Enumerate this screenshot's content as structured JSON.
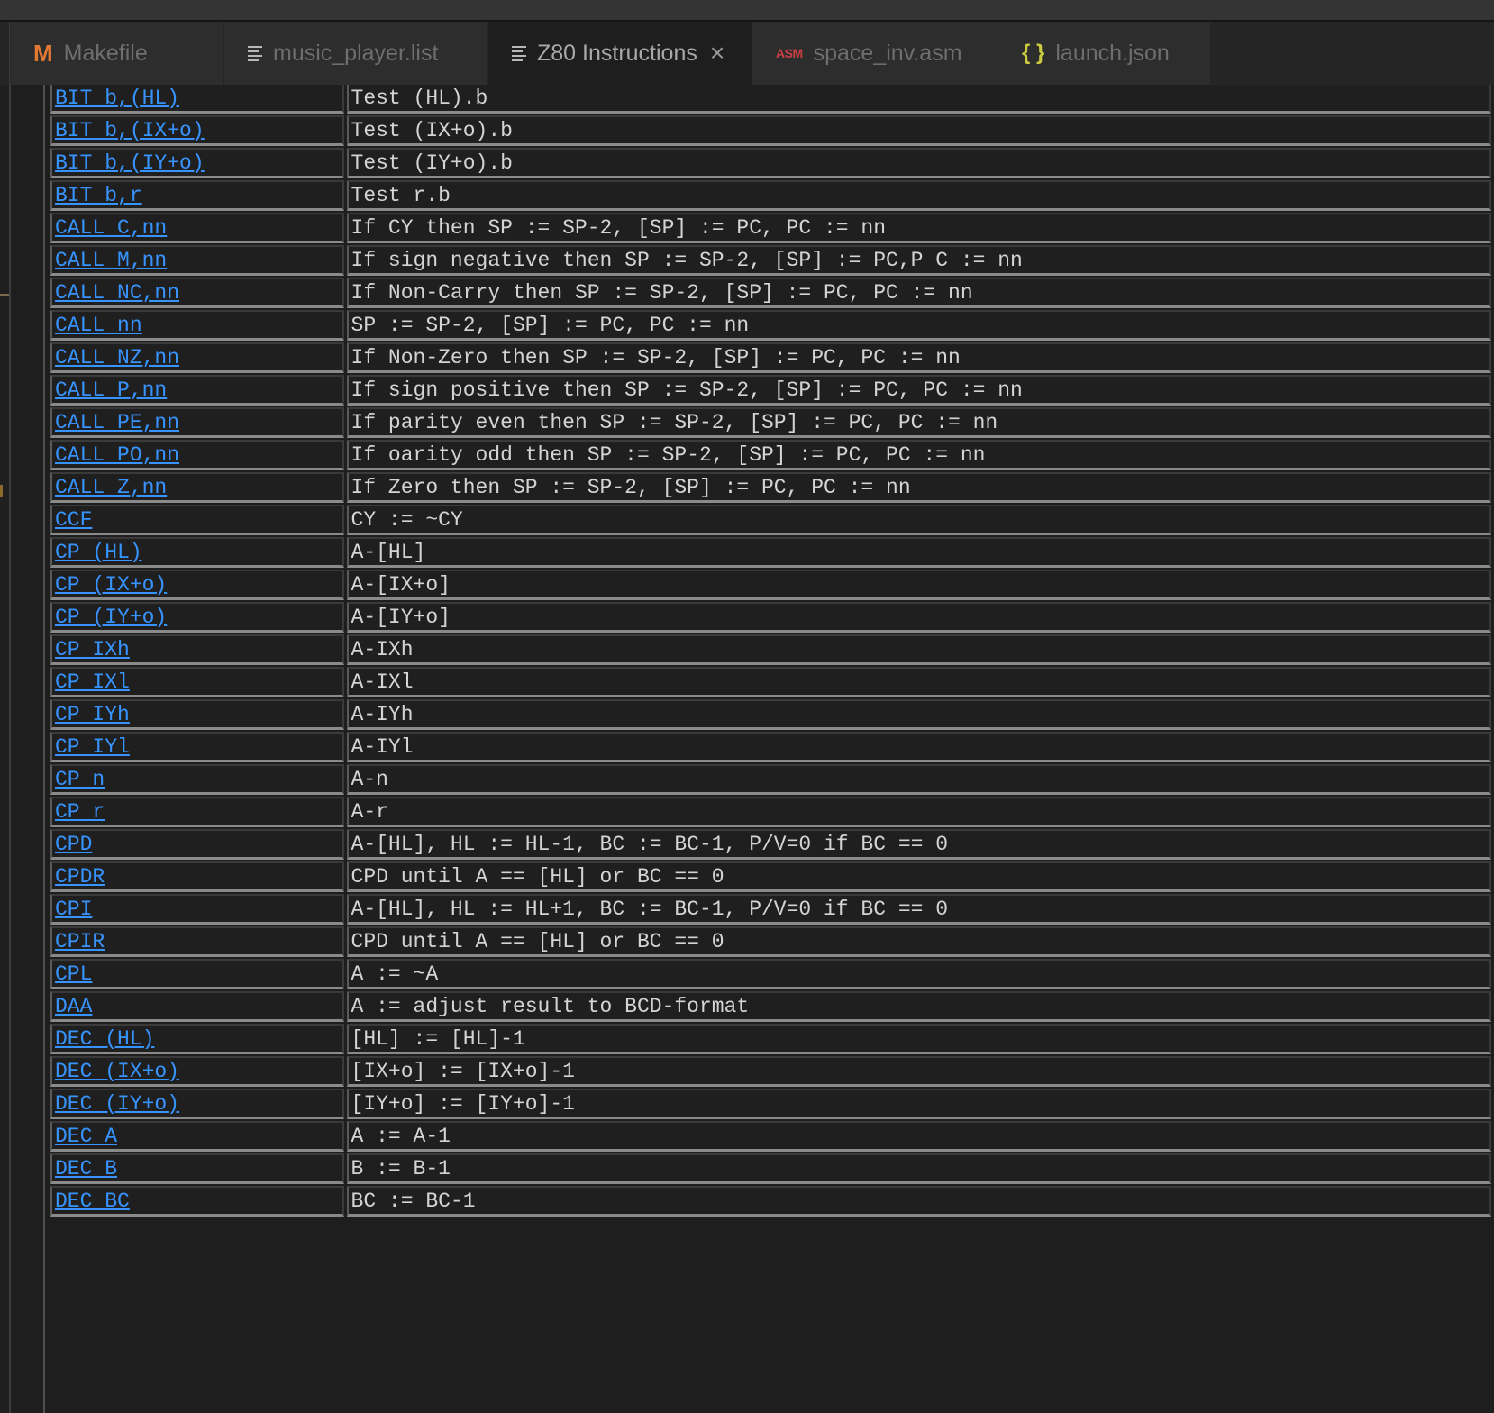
{
  "tabs": [
    {
      "label": "Makefile",
      "icon": "makefile-icon",
      "icon_text": "M",
      "active": false
    },
    {
      "label": "music_player.list",
      "icon": "text-lines-icon",
      "active": false
    },
    {
      "label": "Z80 Instructions",
      "icon": "text-lines-icon",
      "active": true,
      "close": "×"
    },
    {
      "label": "space_inv.asm",
      "icon": "asm-icon",
      "icon_text": "ASM",
      "active": false
    },
    {
      "label": "launch.json",
      "icon": "json-braces-icon",
      "icon_text": "{ }",
      "active": false
    }
  ],
  "colors": {
    "link": "#3794ff",
    "makefile_icon": "#e37933",
    "asm_icon": "#cc3e44",
    "json_icon": "#cbcb41"
  },
  "instructions": [
    {
      "mnemonic": "BIT b,(HL)",
      "description": "Test (HL).b"
    },
    {
      "mnemonic": "BIT b,(IX+o)",
      "description": "Test (IX+o).b"
    },
    {
      "mnemonic": "BIT b,(IY+o)",
      "description": "Test (IY+o).b"
    },
    {
      "mnemonic": "BIT b,r",
      "description": "Test r.b"
    },
    {
      "mnemonic": "CALL C,nn",
      "description": "If CY then SP := SP-2, [SP] := PC, PC := nn"
    },
    {
      "mnemonic": "CALL M,nn",
      "description": "If sign negative then SP := SP-2, [SP] := PC,P C := nn"
    },
    {
      "mnemonic": "CALL NC,nn",
      "description": "If Non-Carry then SP := SP-2, [SP] := PC, PC := nn"
    },
    {
      "mnemonic": "CALL nn",
      "description": "SP := SP-2, [SP] := PC, PC := nn"
    },
    {
      "mnemonic": "CALL NZ,nn",
      "description": "If Non-Zero then SP := SP-2, [SP] := PC, PC := nn"
    },
    {
      "mnemonic": "CALL P,nn",
      "description": "If sign positive then SP := SP-2, [SP] := PC, PC := nn"
    },
    {
      "mnemonic": "CALL PE,nn",
      "description": "If parity even then SP := SP-2, [SP] := PC, PC := nn"
    },
    {
      "mnemonic": "CALL PO,nn",
      "description": "If oarity odd then SP := SP-2, [SP] := PC, PC := nn"
    },
    {
      "mnemonic": "CALL Z,nn",
      "description": "If Zero then SP := SP-2, [SP] := PC, PC := nn"
    },
    {
      "mnemonic": "CCF",
      "description": "CY := ~CY"
    },
    {
      "mnemonic": "CP (HL)",
      "description": "A-[HL]"
    },
    {
      "mnemonic": "CP (IX+o)",
      "description": "A-[IX+o]"
    },
    {
      "mnemonic": "CP (IY+o)",
      "description": "A-[IY+o]"
    },
    {
      "mnemonic": "CP IXh",
      "description": "A-IXh"
    },
    {
      "mnemonic": "CP IXl",
      "description": "A-IXl"
    },
    {
      "mnemonic": "CP IYh",
      "description": "A-IYh"
    },
    {
      "mnemonic": "CP IYl",
      "description": "A-IYl"
    },
    {
      "mnemonic": "CP n",
      "description": "A-n"
    },
    {
      "mnemonic": "CP r",
      "description": "A-r"
    },
    {
      "mnemonic": "CPD",
      "description": "A-[HL], HL := HL-1, BC := BC-1, P/V=0 if BC == 0"
    },
    {
      "mnemonic": "CPDR",
      "description": "CPD until A == [HL] or BC == 0"
    },
    {
      "mnemonic": "CPI",
      "description": "A-[HL], HL := HL+1, BC := BC-1, P/V=0 if BC == 0"
    },
    {
      "mnemonic": "CPIR",
      "description": "CPD until A == [HL] or BC == 0"
    },
    {
      "mnemonic": "CPL",
      "description": "A := ~A"
    },
    {
      "mnemonic": "DAA",
      "description": "A := adjust result to BCD-format"
    },
    {
      "mnemonic": "DEC (HL)",
      "description": "[HL] := [HL]-1"
    },
    {
      "mnemonic": "DEC (IX+o)",
      "description": "[IX+o] := [IX+o]-1"
    },
    {
      "mnemonic": "DEC (IY+o)",
      "description": "[IY+o] := [IY+o]-1"
    },
    {
      "mnemonic": "DEC A",
      "description": "A := A-1"
    },
    {
      "mnemonic": "DEC B",
      "description": "B := B-1"
    },
    {
      "mnemonic": "DEC BC",
      "description": "BC := BC-1"
    }
  ]
}
